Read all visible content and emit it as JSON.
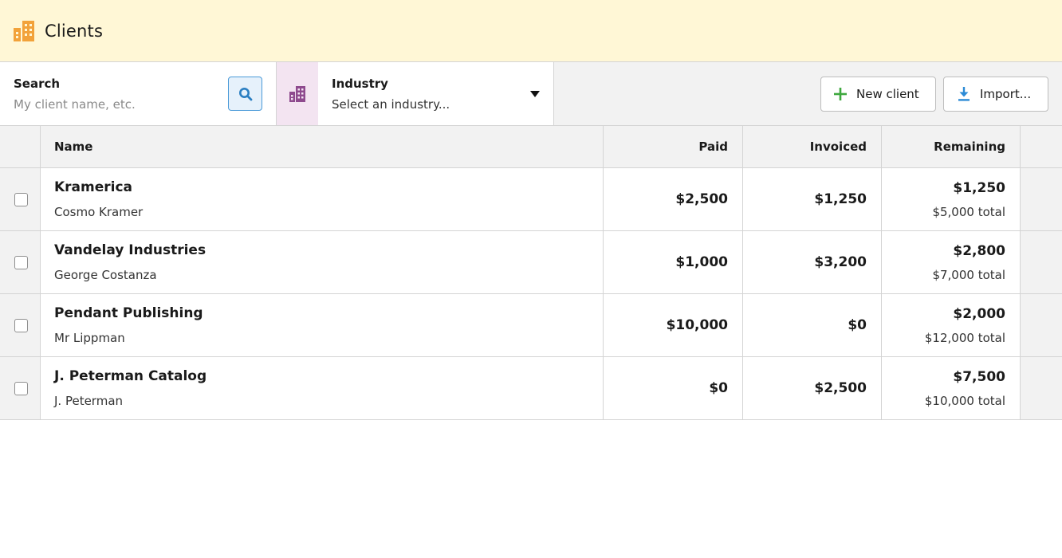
{
  "header": {
    "title": "Clients",
    "icon": "building-icon",
    "icon_color": "#f2a23a"
  },
  "search": {
    "label": "Search",
    "placeholder": "My client name, etc.",
    "accent": "#2b7fc2"
  },
  "industry": {
    "label": "Industry",
    "value": "Select an industry...",
    "icon": "building-icon",
    "icon_color": "#8e4a8e"
  },
  "actions": {
    "new_client": "New client",
    "import": "Import...",
    "new_color": "#3ea83e",
    "import_color": "#2b8ad6"
  },
  "table": {
    "columns": {
      "name": "Name",
      "paid": "Paid",
      "invoiced": "Invoiced",
      "remaining": "Remaining"
    },
    "rows": [
      {
        "name": "Kramerica",
        "contact": "Cosmo Kramer",
        "paid": "$2,500",
        "invoiced": "$1,250",
        "remaining": "$1,250",
        "total": "$5,000 total"
      },
      {
        "name": "Vandelay Industries",
        "contact": "George Costanza",
        "paid": "$1,000",
        "invoiced": "$3,200",
        "remaining": "$2,800",
        "total": "$7,000 total"
      },
      {
        "name": "Pendant Publishing",
        "contact": "Mr Lippman",
        "paid": "$10,000",
        "invoiced": "$0",
        "remaining": "$2,000",
        "total": "$12,000 total"
      },
      {
        "name": "J. Peterman Catalog",
        "contact": "J. Peterman",
        "paid": "$0",
        "invoiced": "$2,500",
        "remaining": "$7,500",
        "total": "$10,000 total"
      }
    ]
  }
}
